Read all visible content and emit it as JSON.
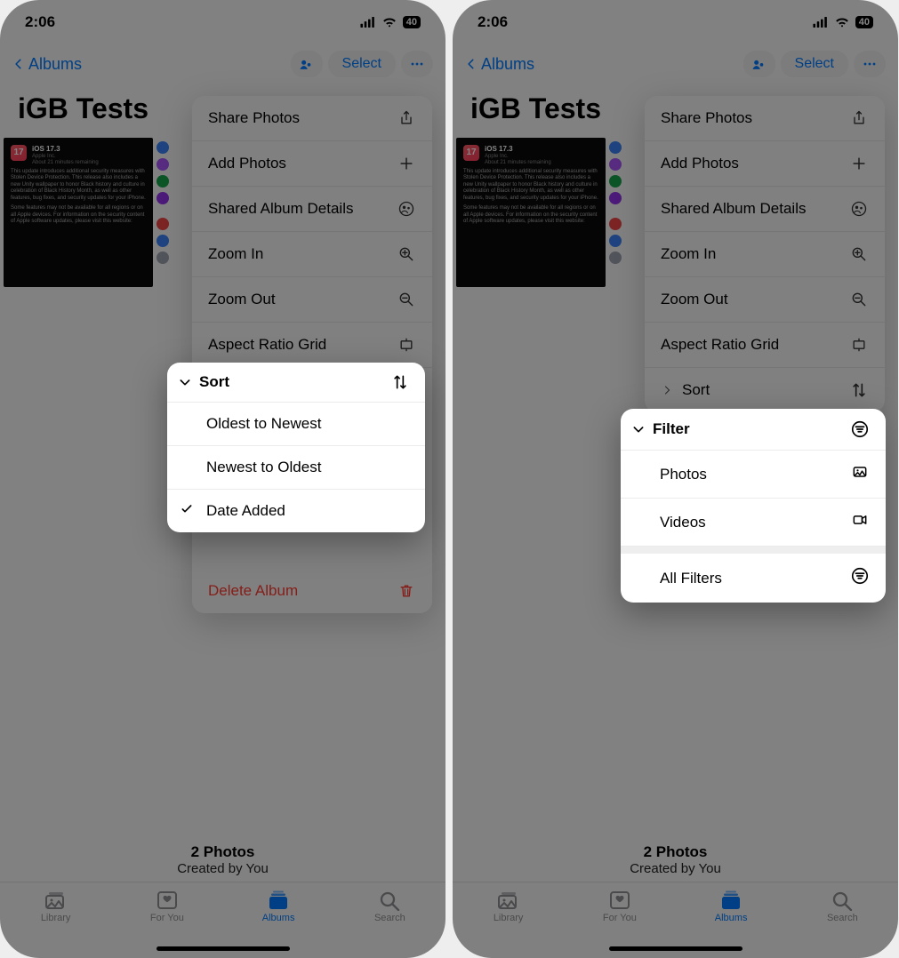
{
  "status": {
    "time": "2:06",
    "battery": "40"
  },
  "nav": {
    "back_label": "Albums",
    "select_label": "Select"
  },
  "album": {
    "title": "iGB Tests"
  },
  "thumb": {
    "ver": "iOS 17.3",
    "brand": "Apple Inc.",
    "ago": "About 21 minutes remaining",
    "body1": "This update introduces additional security measures with Stolen Device Protection. This release also includes a new Unity wallpaper to honor Black history and culture in celebration of Black History Month, as well as other features, bug fixes, and security updates for your iPhone.",
    "body2": "Some features may not be available for all regions or on all Apple devices. For information on the security content of Apple software updates, please visit this website:"
  },
  "context_menu": {
    "share_photos": "Share Photos",
    "add_photos": "Add Photos",
    "shared_album_details": "Shared Album Details",
    "zoom_in": "Zoom In",
    "zoom_out": "Zoom Out",
    "aspect_ratio_grid": "Aspect Ratio Grid",
    "sort": "Sort",
    "delete_album": "Delete Album"
  },
  "sort_popup": {
    "title": "Sort",
    "oldest_to_newest": "Oldest to Newest",
    "newest_to_oldest": "Newest to Oldest",
    "date_added": "Date Added"
  },
  "filter_popup": {
    "title": "Filter",
    "photos": "Photos",
    "videos": "Videos",
    "all_filters": "All Filters"
  },
  "footer": {
    "count": "2 Photos",
    "sub": "Created by You"
  },
  "tabs": {
    "library": "Library",
    "for_you": "For You",
    "albums": "Albums",
    "search": "Search"
  }
}
